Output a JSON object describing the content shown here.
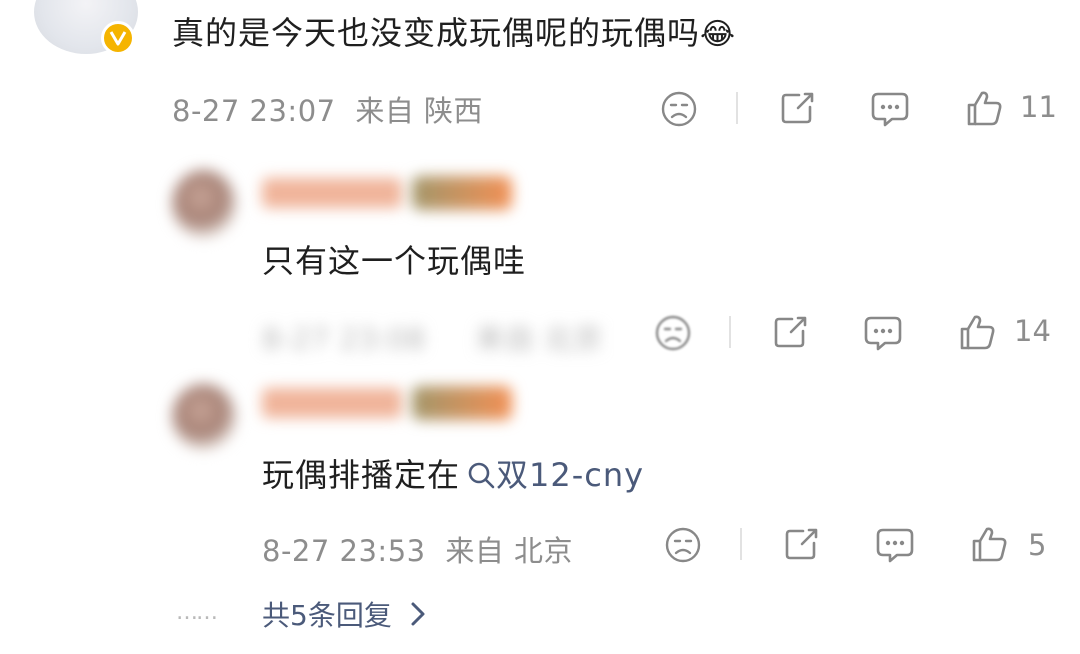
{
  "main_comment": {
    "text": "真的是今天也没变成玩偶呢的玩偶吗",
    "emoji": "😂",
    "time": "8-27 23:07",
    "location": "来自 陕西",
    "likes": "11"
  },
  "replies": [
    {
      "text": "只有这一个玩偶哇",
      "time": "8-27 23:08",
      "location": "来自 北京",
      "likes": "14"
    },
    {
      "text_prefix": "玩偶排播定在",
      "topic": "双12-cny",
      "time": "8-27 23:53",
      "location": "来自 北京",
      "likes": "5"
    }
  ],
  "more_replies": {
    "dots": "……",
    "label": "共5条回复"
  },
  "colors": {
    "verified_badge": "#f5b400",
    "meta_gray": "#8d8d8d",
    "topic_blue": "#4b5a7a"
  }
}
